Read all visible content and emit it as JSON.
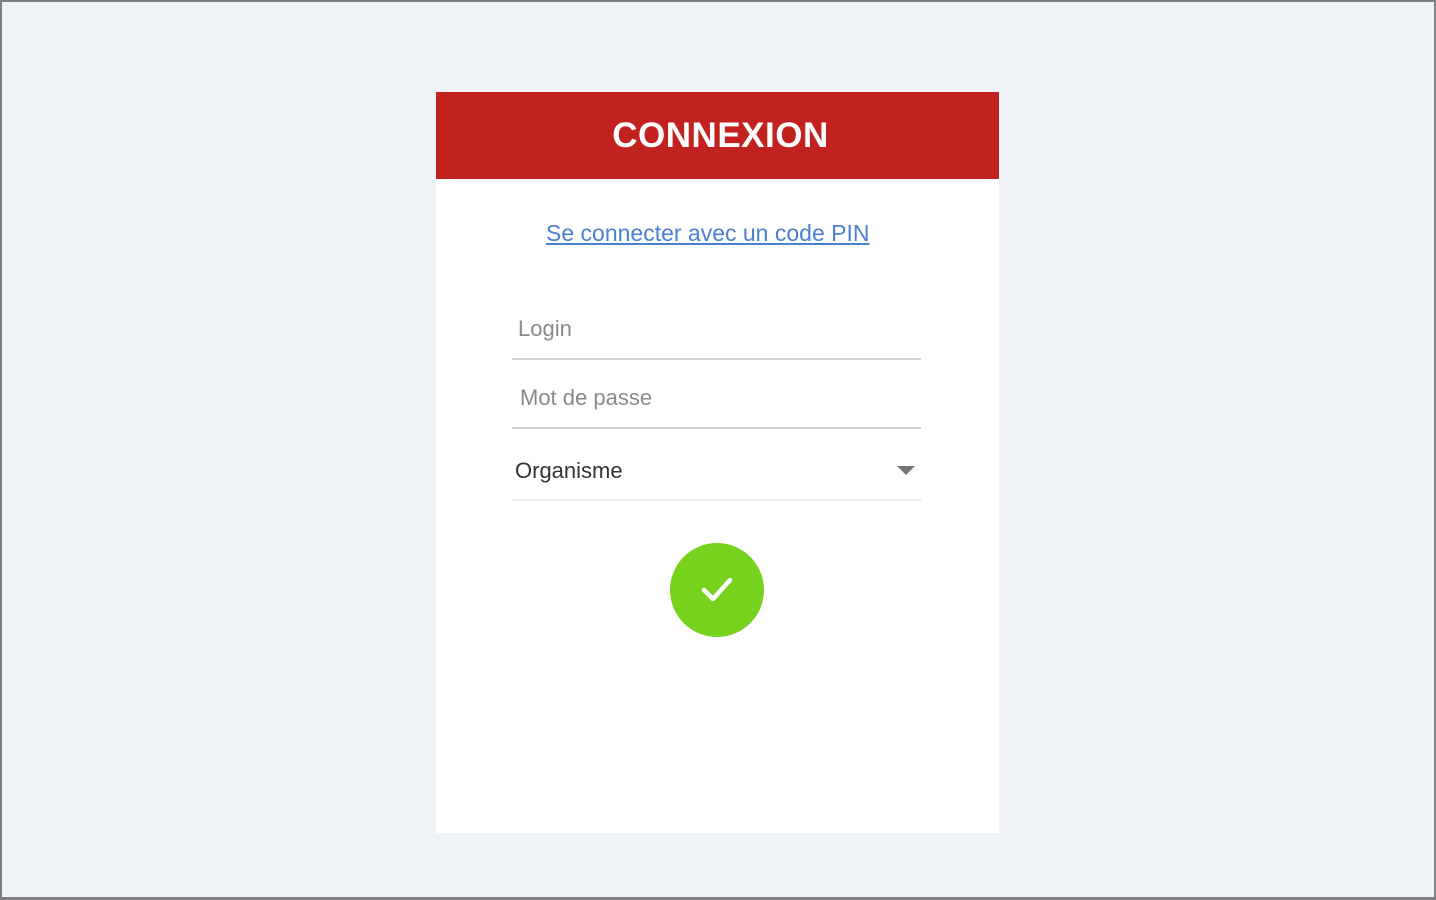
{
  "login_card": {
    "title": "CONNEXION",
    "pin_link_label": "Se connecter avec un code PIN",
    "login_placeholder": "Login",
    "password_placeholder": "Mot de passe",
    "organism_select_value": "Organisme",
    "submit_icon": "check-icon"
  },
  "colors": {
    "header_bg": "#c1221f",
    "link": "#4a7fd1",
    "submit_bg": "#76d21c",
    "page_bg": "#eff2f7"
  }
}
